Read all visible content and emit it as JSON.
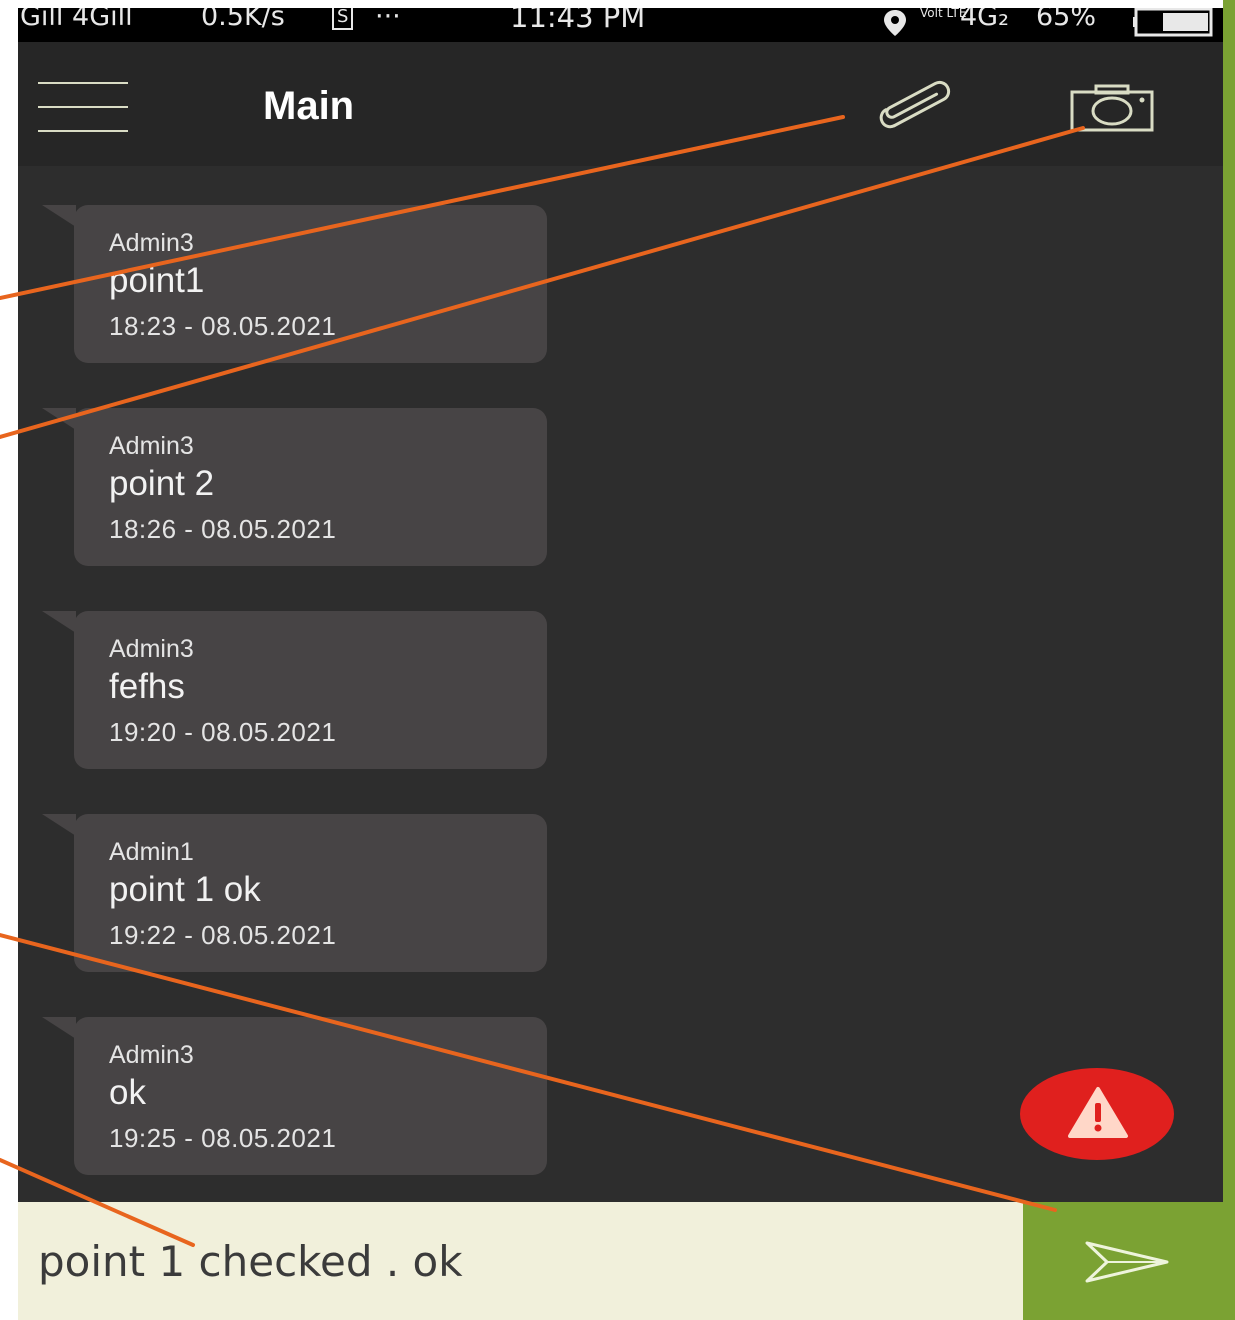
{
  "status_bar": {
    "network": "Gıll 4Gıll",
    "speed": "0.5K/s",
    "sim_badge": "S",
    "dots": "···",
    "time": "11:43 PM",
    "lte": "Volt LTE",
    "net_type": "4G₂",
    "battery": "65%"
  },
  "header": {
    "title": "Main",
    "icons": [
      "menu-icon",
      "paperclip-icon",
      "camera-icon"
    ]
  },
  "messages": [
    {
      "sender": "Admin3",
      "text": "point1",
      "time": "18:23 - 08.05.2021"
    },
    {
      "sender": "Admin3",
      "text": "point 2",
      "time": "18:26 - 08.05.2021"
    },
    {
      "sender": "Admin3",
      "text": "fefhs",
      "time": "19:20 - 08.05.2021"
    },
    {
      "sender": "Admin1",
      "text": "point 1 ok",
      "time": "19:22 - 08.05.2021"
    },
    {
      "sender": "Admin3",
      "text": "ok",
      "time": "19:25 - 08.05.2021"
    }
  ],
  "composer": {
    "value": "point 1 checked . ok",
    "send_icon": "send-icon"
  },
  "alert_button": {
    "icon": "warning-icon"
  },
  "colors": {
    "background": "#2d2d2d",
    "app_bar": "#262626",
    "bubble": "#474445",
    "accent_green": "#7ba233",
    "composer": "#f1f0db",
    "alert_red": "#e0201e",
    "annotation": "#e8651e"
  }
}
